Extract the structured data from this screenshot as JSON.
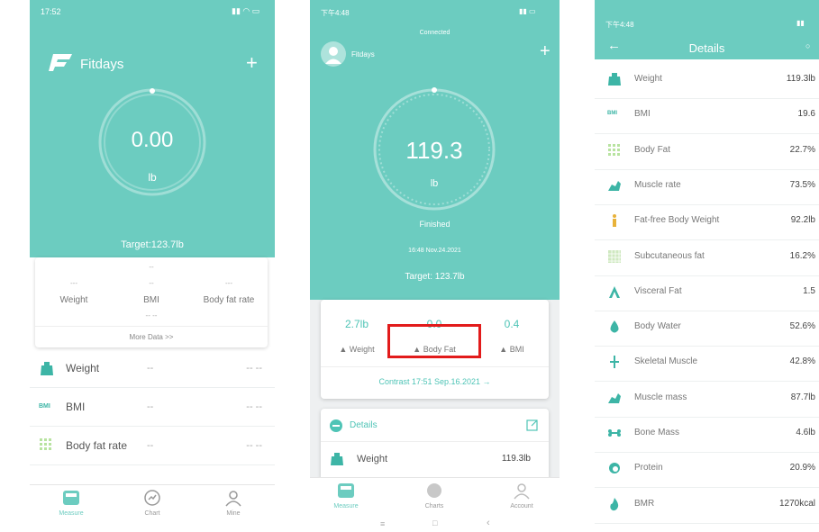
{
  "colors": {
    "teal": "#6cccc0",
    "red_highlight": "#e21b1b",
    "accent_blue": "#4fc4b6"
  },
  "phone1": {
    "status": {
      "time": "17:52",
      "signal": "..ıl",
      "wifi": "wifi",
      "battery": "battery"
    },
    "app_name": "Fitdays",
    "add_icon": "+",
    "gauge": {
      "value": "0.00",
      "unit": "lb"
    },
    "target": "Target:123.7lb",
    "summary": {
      "top_dash": "--",
      "cols": [
        {
          "value": "---",
          "label": "Weight"
        },
        {
          "value": "--",
          "label": "BMI"
        },
        {
          "value": "---",
          "label": "Body fat rate"
        }
      ],
      "mid_dash": "-- --",
      "more": "More Data >>"
    },
    "rows": [
      {
        "label": "Weight",
        "value": "--",
        "right": "-- --"
      },
      {
        "label": "BMI",
        "value": "--",
        "right": "-- --"
      },
      {
        "label": "Body fat rate",
        "value": "--",
        "right": "-- --"
      }
    ],
    "nav": [
      "Measure",
      "Chart",
      "Mine"
    ]
  },
  "phone2": {
    "status": {
      "time": "下午4:48",
      "connection": "Connected"
    },
    "user": "Fitdays",
    "add_icon": "+",
    "gauge": {
      "value": "119.3",
      "unit": "lb"
    },
    "state": "Finished",
    "datetime": "16:48 Nov.24.2021",
    "target": "Target: 123.7lb",
    "compare": {
      "cols": [
        {
          "value": "2.7lb",
          "label": "Weight"
        },
        {
          "value": "0.0",
          "label": "Body Fat"
        },
        {
          "value": "0.4",
          "label": "BMI"
        }
      ],
      "contrast": "Contrast 17:51 Sep.16.2021 →"
    },
    "details_title": "Details",
    "detail_row": {
      "label": "Weight",
      "value": "119.3lb"
    },
    "nav": [
      "Measure",
      "Charts",
      "Account"
    ],
    "sysnav": [
      "≡",
      "□",
      "‹"
    ]
  },
  "phone3": {
    "status": {
      "time": "下午4:48"
    },
    "title": "Details",
    "rows": [
      {
        "label": "Weight",
        "value": "119.3lb",
        "icon": "scale-icon"
      },
      {
        "label": "BMI",
        "value": "19.6",
        "icon": "bmi-icon"
      },
      {
        "label": "Body Fat",
        "value": "22.7%",
        "icon": "body-fat-icon"
      },
      {
        "label": "Muscle rate",
        "value": "73.5%",
        "icon": "muscle-icon"
      },
      {
        "label": "Fat-free Body Weight",
        "value": "92.2lb",
        "icon": "person-icon"
      },
      {
        "label": "Subcutaneous fat",
        "value": "16.2%",
        "icon": "grid-icon"
      },
      {
        "label": "Visceral Fat",
        "value": "1.5",
        "icon": "visceral-icon"
      },
      {
        "label": "Body Water",
        "value": "52.6%",
        "icon": "water-drop-icon"
      },
      {
        "label": "Skeletal Muscle",
        "value": "42.8%",
        "icon": "skeletal-icon"
      },
      {
        "label": "Muscle mass",
        "value": "87.7lb",
        "icon": "muscle-mass-icon"
      },
      {
        "label": "Bone Mass",
        "value": "4.6lb",
        "icon": "bone-icon"
      },
      {
        "label": "Protein",
        "value": "20.9%",
        "icon": "protein-icon"
      },
      {
        "label": "BMR",
        "value": "1270kcal",
        "icon": "flame-icon"
      }
    ]
  }
}
